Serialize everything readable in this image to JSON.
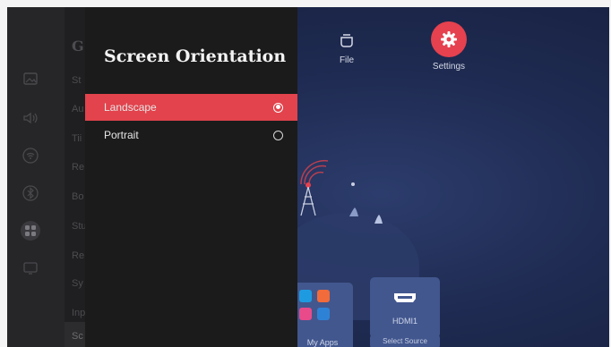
{
  "dialog": {
    "title": "Screen Orientation",
    "options": [
      {
        "label": "Landscape",
        "selected": true
      },
      {
        "label": "Portrait",
        "selected": false
      }
    ]
  },
  "top_apps": [
    {
      "label": "File",
      "icon": "folder-icon"
    },
    {
      "label": "Settings",
      "icon": "gear-icon"
    }
  ],
  "sources": {
    "apps_label": "My Apps",
    "hdmi_label": "HDMI1",
    "select_source": "Select Source"
  },
  "settings_menu": {
    "header_initial": "G",
    "items": [
      "St",
      "Au",
      "Tii",
      "Re",
      "Bo",
      "Stu",
      "Re",
      "Sy",
      "Inp",
      "Sc"
    ]
  },
  "rail_icons": [
    "picture-icon",
    "sound-icon",
    "wifi-icon",
    "bluetooth-icon",
    "apps-icon",
    "screen-icon"
  ],
  "colors": {
    "accent": "#e2434c",
    "dialog_bg": "#1b1b1b",
    "background": "#1f2b52"
  }
}
